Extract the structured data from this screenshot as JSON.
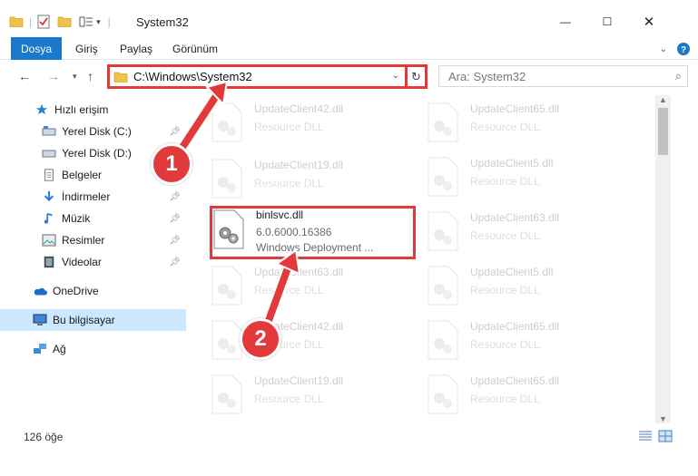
{
  "window": {
    "title": "System32",
    "minimize": "—",
    "maximize": "☐",
    "close": "✕"
  },
  "ribbon": {
    "tabs": [
      "Dosya",
      "Giriş",
      "Paylaş",
      "Görünüm"
    ],
    "accent": "#1979ca"
  },
  "nav": {
    "address": "C:\\Windows\\System32",
    "search_placeholder": "Ara: System32"
  },
  "sidebar": {
    "items": [
      {
        "label": "Hızlı erişim",
        "icon": "star-icon",
        "pinned": false
      },
      {
        "label": "Yerel Disk (C:)",
        "icon": "drive-icon",
        "pinned": true
      },
      {
        "label": "Yerel Disk (D:)",
        "icon": "drive-icon",
        "pinned": false
      },
      {
        "label": "Belgeler",
        "icon": "documents-icon",
        "pinned": true
      },
      {
        "label": "İndirmeler",
        "icon": "download-icon",
        "pinned": true
      },
      {
        "label": "Müzik",
        "icon": "music-icon",
        "pinned": true
      },
      {
        "label": "Resimler",
        "icon": "pictures-icon",
        "pinned": true
      },
      {
        "label": "Videolar",
        "icon": "videos-icon",
        "pinned": true
      },
      {
        "label": "OneDrive",
        "icon": "cloud-icon",
        "pinned": false
      },
      {
        "label": "Bu bilgisayar",
        "icon": "computer-icon",
        "pinned": false
      },
      {
        "label": "Ağ",
        "icon": "network-icon",
        "pinned": false
      }
    ]
  },
  "files": {
    "left": [
      {
        "name": "UpdateClient42.dll",
        "desc": "Resource DLL"
      },
      {
        "name": "UpdateClient19.dll",
        "desc": "Resource DLL"
      },
      {
        "name": "UpdateClient63.dll",
        "desc": "Resource DLL"
      },
      {
        "name": "UpdateClient42.dll",
        "desc": "Resource DLL"
      },
      {
        "name": "UpdateClient19.dll",
        "desc": "Resource DLL"
      }
    ],
    "right": [
      {
        "name": "UpdateClient65.dll",
        "desc": "Resource DLL"
      },
      {
        "name": "UpdateClient5.dll",
        "desc": "Resource DLL"
      },
      {
        "name": "UpdateClient63.dll",
        "desc": "Resource DLL"
      },
      {
        "name": "UpdateClient5.dll",
        "desc": "Resource DLL"
      },
      {
        "name": "UpdateClient65.dll",
        "desc": "Resource DLL"
      },
      {
        "name": "UpdateClient65.dll",
        "desc": "Resource DLL"
      }
    ],
    "highlighted": {
      "name": "binlsvc.dll",
      "version": "6.0.6000.16386",
      "desc": "Windows Deployment ..."
    }
  },
  "status": {
    "count": "126 öğe"
  },
  "callouts": [
    "1",
    "2"
  ],
  "colors": {
    "highlight": "#e23a3a",
    "selected": "#cce8ff"
  }
}
